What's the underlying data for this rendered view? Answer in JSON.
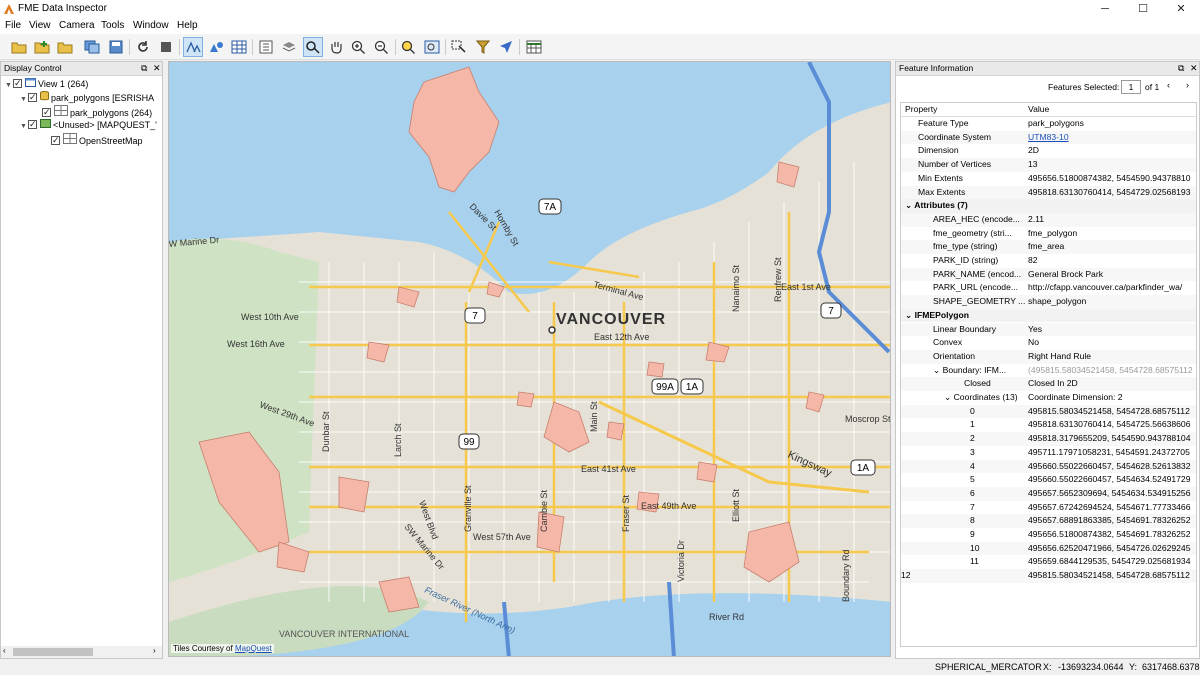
{
  "window": {
    "title": "FME Data Inspector",
    "minimize": "─",
    "maximize": "☐",
    "close": "✕"
  },
  "menu": [
    "File",
    "View",
    "Camera",
    "Tools",
    "Window",
    "Help"
  ],
  "display_control": {
    "title": "Display Control",
    "float_icon": "⧉",
    "close_icon": "✕",
    "tree": [
      {
        "label": "View 1 (264)"
      },
      {
        "label": "park_polygons [ESRISHA"
      },
      {
        "label": "park_polygons (264)"
      },
      {
        "label": "<Unused> [MAPQUEST_'"
      },
      {
        "label": "OpenStreetMap"
      }
    ]
  },
  "map": {
    "labels": {
      "vancouver": "VANCOUVER",
      "hornby": "Hornby St",
      "davie": "Davie St",
      "terminal": "Terminal Ave",
      "w10": "West 10th Ave",
      "w16": "West 16th Ave",
      "w29": "West 29th Ave",
      "e12": "East 12th Ave",
      "e41": "East 41st Ave",
      "e49": "East 49th Ave",
      "w57": "West 57th Ave",
      "e1": "East 1st Ave",
      "main": "Main St",
      "granville": "Granville St",
      "fraser": "Fraser St",
      "victoria": "Victoria Dr",
      "kingsway": "Kingsway",
      "nanaimo": "Nanaimo St",
      "renfrew": "Renfrew St",
      "elliott": "Elliott St",
      "boundary": "Boundary Rd",
      "moscrop": "Moscrop St",
      "larch": "Larch St",
      "dunbar": "Dunbar St",
      "westblvd": "West Blvd",
      "sw_marine": "SW Marine Dr",
      "fraser_river": "Fraser River (North Arm)",
      "river_rd": "River Rd",
      "airport": "VANCOUVER INTERNATIONAL",
      "w_marine": "W Marine Dr",
      "cambie": "Cambie St"
    },
    "shields": [
      "7A",
      "7",
      "7",
      "99A",
      "1A",
      "99",
      "1A"
    ],
    "attribution": "Tiles Courtesy of",
    "attribution_link": "MapQuest"
  },
  "feature_info": {
    "title": "Feature Information",
    "features_selected_label": "Features Selected:",
    "selected_value": "1",
    "of_label": "of 1",
    "headers": {
      "property": "Property",
      "value": "Value"
    },
    "rows": [
      {
        "k": "Feature Type",
        "v": "park_polygons"
      },
      {
        "k": "Coordinate System",
        "v": "UTM83-10",
        "link": true
      },
      {
        "k": "Dimension",
        "v": "2D"
      },
      {
        "k": "Number of Vertices",
        "v": "13"
      },
      {
        "k": "Min Extents",
        "v": "495656.51800874382, 5454590.94378810"
      },
      {
        "k": "Max Extents",
        "v": "495818.63130760414, 5454729.02568193"
      },
      {
        "k": "Attributes (7)",
        "v": "",
        "group": true
      },
      {
        "k": "AREA_HEC (encode...",
        "v": "2.11"
      },
      {
        "k": "fme_geometry (stri...",
        "v": "fme_polygon"
      },
      {
        "k": "fme_type (string)",
        "v": "fme_area"
      },
      {
        "k": "PARK_ID (string)",
        "v": "82"
      },
      {
        "k": "PARK_NAME (encod...",
        "v": "General Brock Park"
      },
      {
        "k": "PARK_URL (encode...",
        "v": "http://cfapp.vancouver.ca/parkfinder_wa/"
      },
      {
        "k": "SHAPE_GEOMETRY ...",
        "v": "shape_polygon"
      },
      {
        "k": "IFMEPolygon",
        "v": "",
        "group": true
      },
      {
        "k": "Linear Boundary",
        "v": "Yes"
      },
      {
        "k": "Convex",
        "v": "No"
      },
      {
        "k": "Orientation",
        "v": "Right Hand Rule"
      },
      {
        "k": "Boundary: IFM...",
        "v": "(495815.58034521458, 5454728.68575112"
      },
      {
        "k": "Closed",
        "v": "Closed In 2D"
      },
      {
        "k": "Coordinates (13)",
        "v": "Coordinate Dimension: 2"
      },
      {
        "k": "0",
        "v": "495815.58034521458, 5454728.68575112"
      },
      {
        "k": "1",
        "v": "495818.63130760414, 5454725.56638606"
      },
      {
        "k": "2",
        "v": "495818.3179655209, 5454590.943788104"
      },
      {
        "k": "3",
        "v": "495711.17971058231, 5454591.24372705"
      },
      {
        "k": "4",
        "v": "495660.55022660457, 5454628.52613832"
      },
      {
        "k": "5",
        "v": "495660.55022660457, 5454634.52491729"
      },
      {
        "k": "6",
        "v": "495657.5652309694, 5454634.534915256"
      },
      {
        "k": "7",
        "v": "495657.67242694524, 5454671.77733466"
      },
      {
        "k": "8",
        "v": "495657.68891863385, 5454691.78326252"
      },
      {
        "k": "9",
        "v": "495656.51800874382, 5454691.78326252"
      },
      {
        "k": "10",
        "v": "495656.62520471966, 5454726.02629245"
      },
      {
        "k": "11",
        "v": "495659.6844129535, 5454729.025681934"
      },
      {
        "k": "12",
        "v": "495815.58034521458, 5454728.68575112"
      }
    ]
  },
  "status": {
    "projection": "SPHERICAL_MERCATOR",
    "x_label": "X:",
    "x": "-13693234.0644",
    "y_label": "Y:",
    "y": "6317468.6378"
  },
  "colors": {
    "park": "#f5b8a8",
    "water": "#a9d3f0",
    "land": "#e8e2d6",
    "highway": "#f6c94c",
    "freeway": "#5b8dd6"
  }
}
